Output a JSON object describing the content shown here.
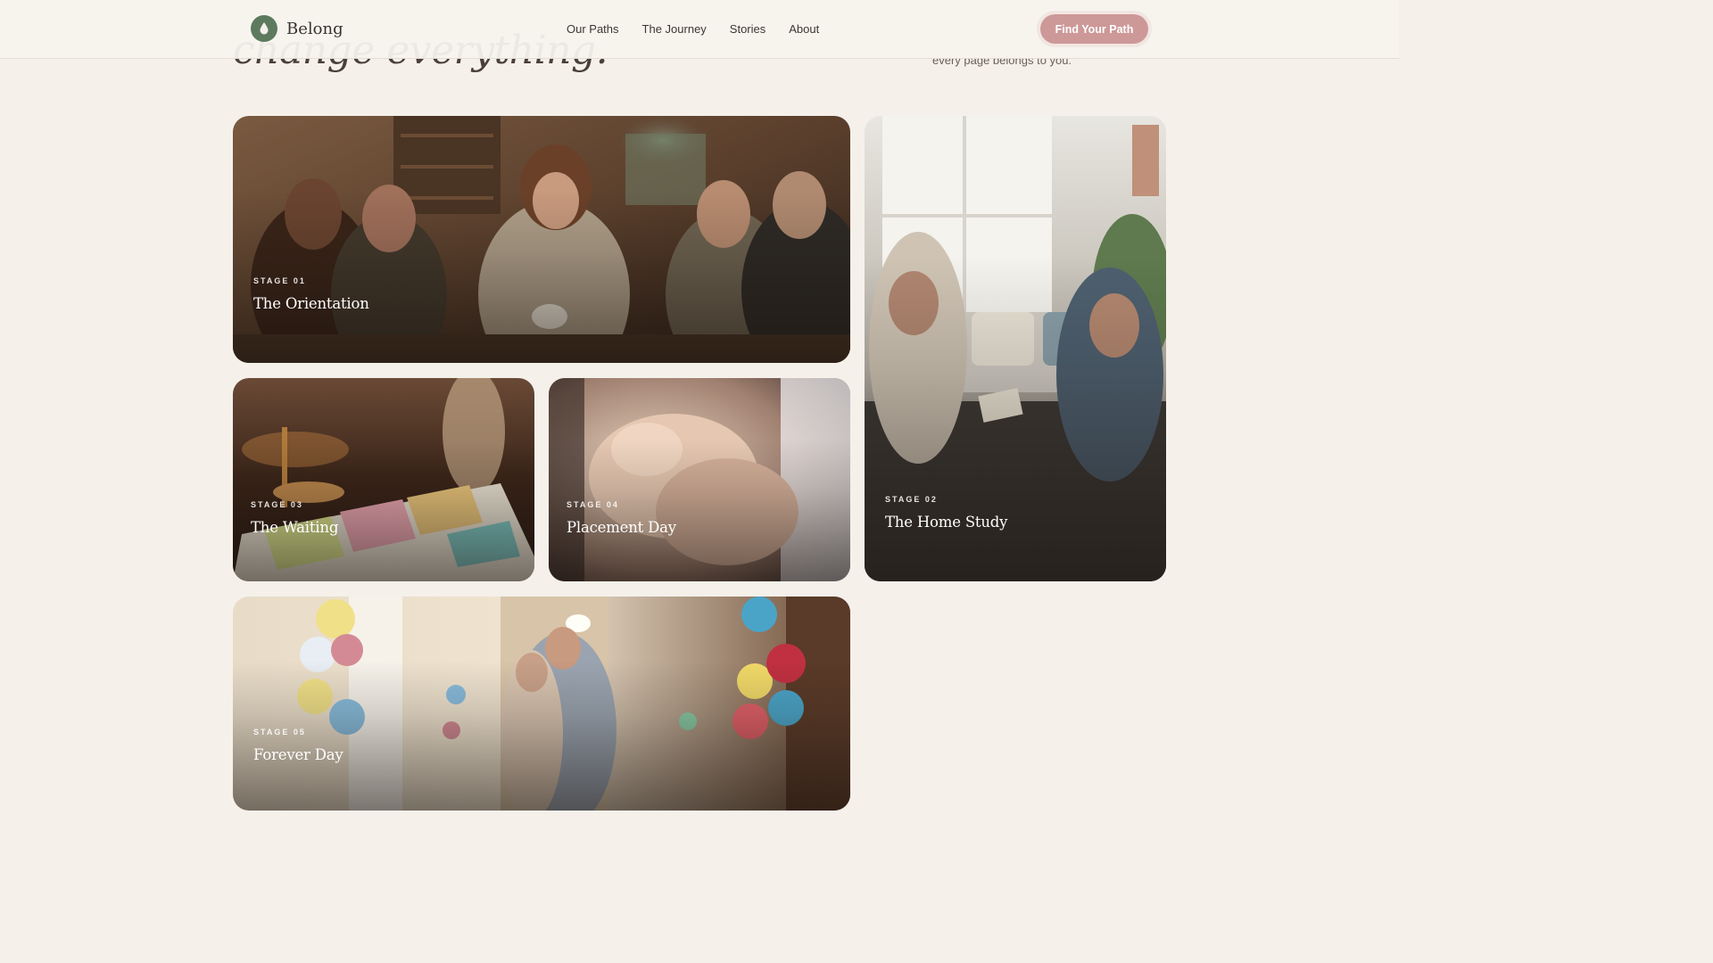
{
  "brand": {
    "name": "Belong",
    "accent": "#5d7a5e",
    "cta_color": "#cd9898"
  },
  "nav": {
    "items": [
      "Our Paths",
      "The Journey",
      "Stories",
      "About"
    ],
    "cta_label": "Find Your Path"
  },
  "hero": {
    "title_fragment": "change everything.",
    "subtitle_fragment": "every page belongs to you."
  },
  "stages": {
    "orientation": {
      "stage": "STAGE 01",
      "title": "The Orientation",
      "image": "group-meeting-photo"
    },
    "home_study": {
      "stage": "STAGE 02",
      "title": "The Home Study",
      "image": "couple-living-room-photo"
    },
    "waiting": {
      "stage": "STAGE 03",
      "title": "The Waiting",
      "image": "calendar-sticky-notes-photo"
    },
    "placement": {
      "stage": "STAGE 04",
      "title": "Placement Day",
      "image": "holding-hands-photo"
    },
    "forever": {
      "stage": "STAGE 05",
      "title": "Forever Day",
      "image": "family-celebration-balloons-photo"
    }
  }
}
